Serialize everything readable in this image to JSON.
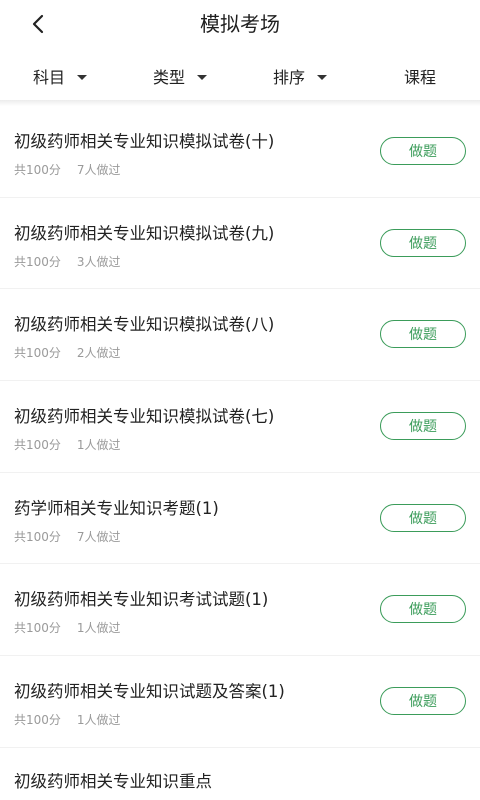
{
  "header": {
    "title": "模拟考场"
  },
  "filters": [
    {
      "label": "科目",
      "dropdown": true
    },
    {
      "label": "类型",
      "dropdown": true
    },
    {
      "label": "排序",
      "dropdown": true
    },
    {
      "label": "课程",
      "dropdown": false
    }
  ],
  "action_label": "做题",
  "exams": [
    {
      "title": "初级药师相关专业知识模拟试卷(十)",
      "score": "共100分",
      "count": "7人做过"
    },
    {
      "title": "初级药师相关专业知识模拟试卷(九)",
      "score": "共100分",
      "count": "3人做过"
    },
    {
      "title": "初级药师相关专业知识模拟试卷(八)",
      "score": "共100分",
      "count": "2人做过"
    },
    {
      "title": "初级药师相关专业知识模拟试卷(七)",
      "score": "共100分",
      "count": "1人做过"
    },
    {
      "title": "药学师相关专业知识考题(1)",
      "score": "共100分",
      "count": "7人做过"
    },
    {
      "title": "初级药师相关专业知识考试试题(1)",
      "score": "共100分",
      "count": "1人做过"
    },
    {
      "title": "初级药师相关专业知识试题及答案(1)",
      "score": "共100分",
      "count": "1人做过"
    }
  ],
  "partial_item": {
    "title": "初级药师相关专业知识重点"
  },
  "colors": {
    "accent": "#3b9c5a",
    "meta_text": "#9a9a9a"
  }
}
